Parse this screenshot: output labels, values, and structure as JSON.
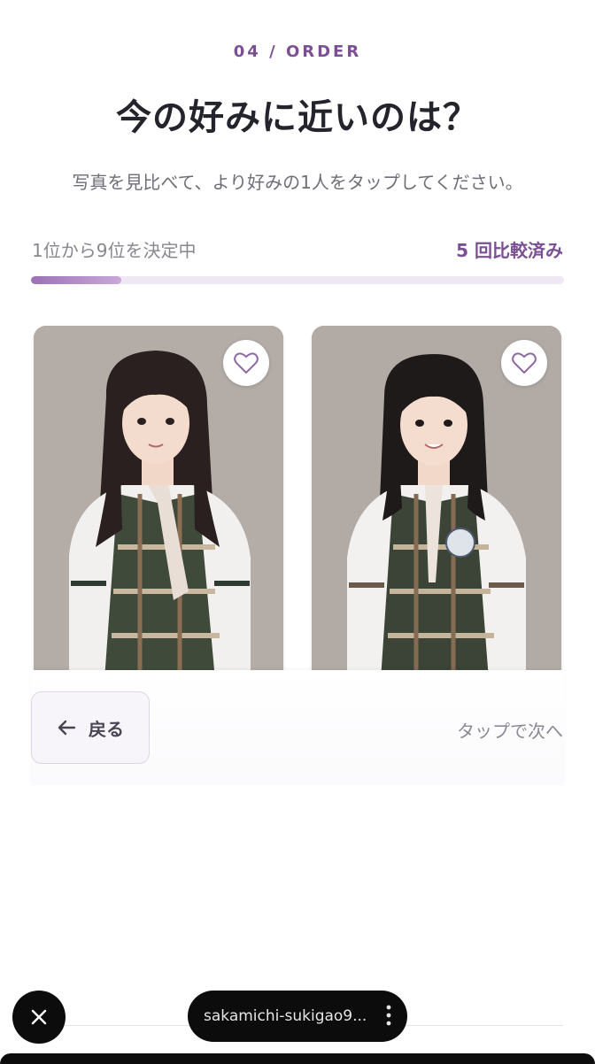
{
  "header": {
    "step": "04 / ORDER",
    "title": "今の好みに近いのは？",
    "subtitle": "写真を見比べて、より好みの1人をタップしてください。"
  },
  "progress": {
    "label": "1位から9位を決定中",
    "count_label": "5 回比較済み",
    "fraction": 0.17
  },
  "cards": [
    {
      "photo_alt": "portrait-left",
      "favorite_icon": "heart-outline-icon"
    },
    {
      "photo_alt": "portrait-right",
      "favorite_icon": "heart-outline-icon"
    }
  ],
  "footer": {
    "back_label": "戻る",
    "tap_hint": "タップで次へ"
  },
  "browser": {
    "url": "sakamichi-sukigao9..."
  },
  "colors": {
    "accent": "#7b4f93",
    "progress_track": "#efe7f3",
    "progress_fill": "#9d71b6"
  }
}
